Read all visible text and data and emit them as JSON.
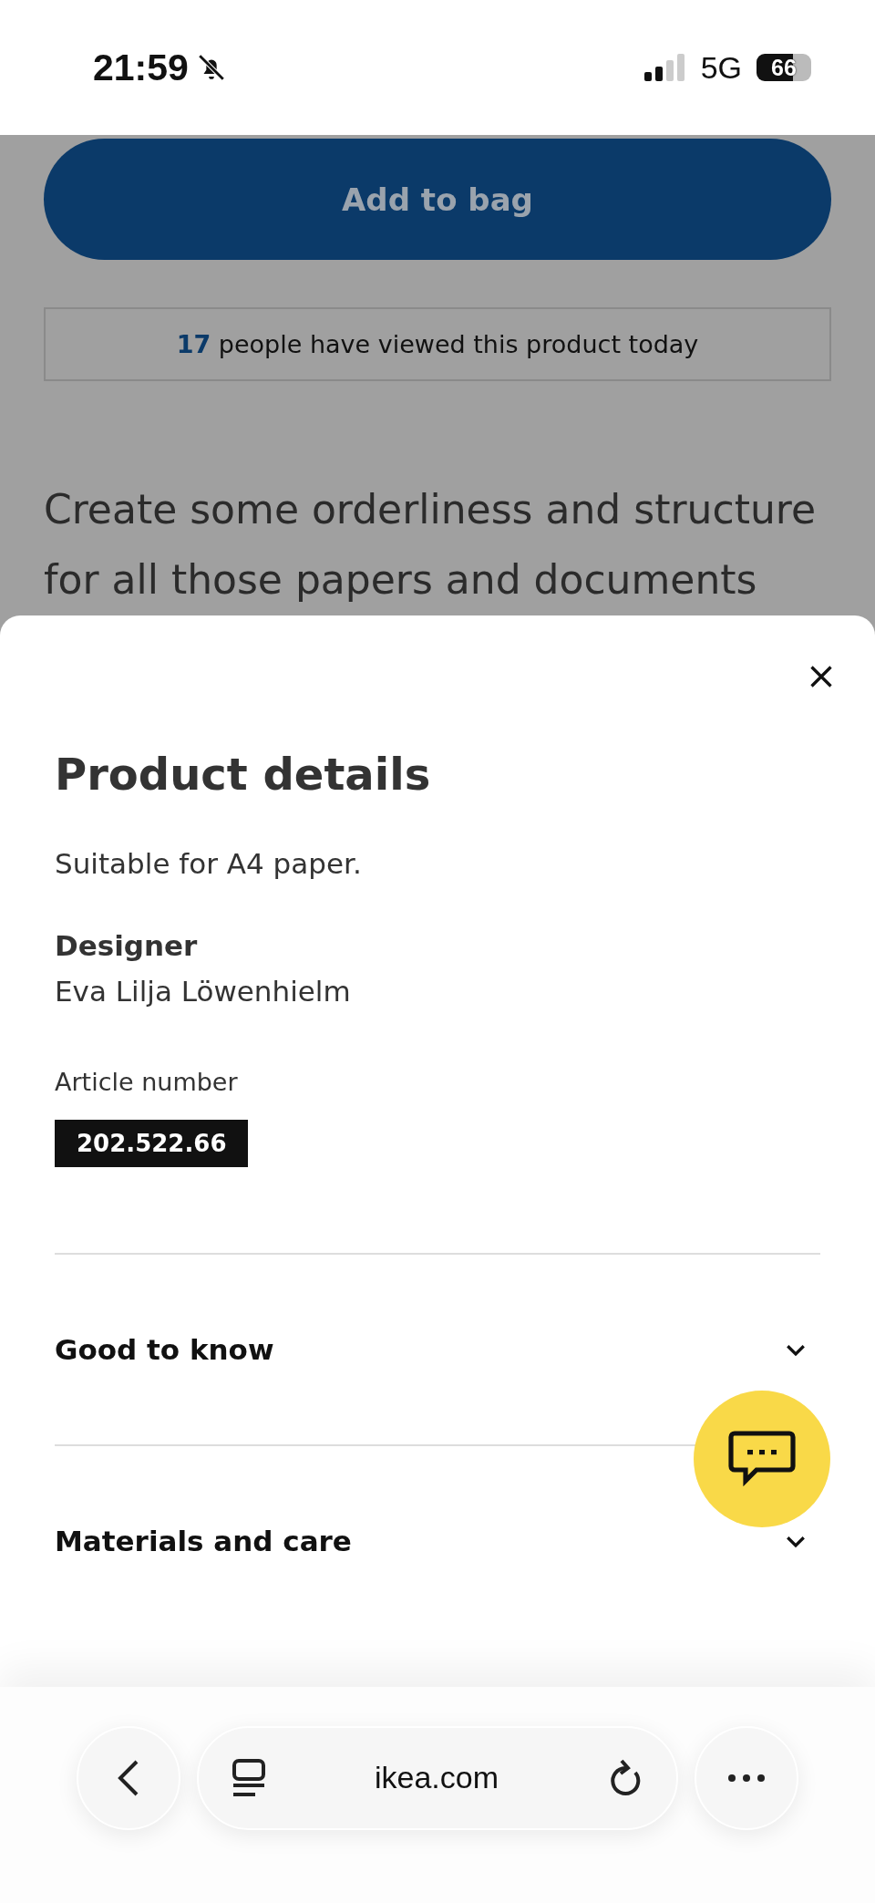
{
  "status_bar": {
    "time": "21:59",
    "silent": true,
    "network": "5G",
    "battery": "66"
  },
  "page": {
    "add_button": "Add to bag",
    "views": {
      "count": "17",
      "text": "people have viewed this product today"
    },
    "description": "Create some orderliness and structure for all those papers and documents"
  },
  "sheet": {
    "title": "Product details",
    "summary": "Suitable for A4 paper.",
    "designer_label": "Designer",
    "designer": "Eva Lilja Löwenhielm",
    "article_label": "Article number",
    "article_number": "202.522.66",
    "sections": [
      {
        "label": "Good to know",
        "expanded": false
      },
      {
        "label": "Materials and care",
        "expanded": false
      }
    ]
  },
  "browser_bar": {
    "url": "ikea.com"
  }
}
